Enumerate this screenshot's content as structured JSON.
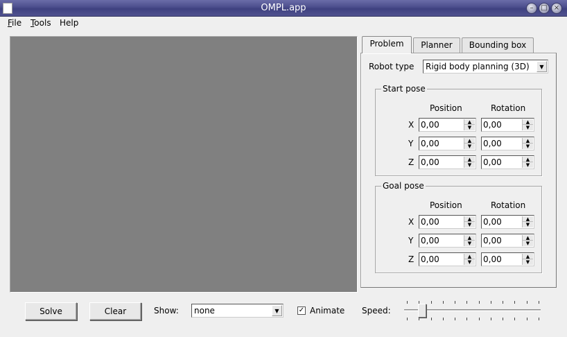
{
  "window": {
    "title": "OMPL.app"
  },
  "menu": {
    "file": "File",
    "tools": "Tools",
    "help": "Help"
  },
  "tabs": [
    {
      "label": "Problem",
      "active": true
    },
    {
      "label": "Planner",
      "active": false
    },
    {
      "label": "Bounding box",
      "active": false
    }
  ],
  "problem": {
    "robot_type_label": "Robot type",
    "robot_type_value": "Rigid body planning (3D)",
    "start_pose": {
      "title": "Start pose",
      "position_header": "Position",
      "rotation_header": "Rotation",
      "rows": [
        {
          "axis": "X",
          "position": "0,00",
          "rotation": "0,00"
        },
        {
          "axis": "Y",
          "position": "0,00",
          "rotation": "0,00"
        },
        {
          "axis": "Z",
          "position": "0,00",
          "rotation": "0,00"
        }
      ]
    },
    "goal_pose": {
      "title": "Goal pose",
      "position_header": "Position",
      "rotation_header": "Rotation",
      "rows": [
        {
          "axis": "X",
          "position": "0,00",
          "rotation": "0,00"
        },
        {
          "axis": "Y",
          "position": "0,00",
          "rotation": "0,00"
        },
        {
          "axis": "Z",
          "position": "0,00",
          "rotation": "0,00"
        }
      ]
    }
  },
  "bottom": {
    "solve_label": "Solve",
    "clear_label": "Clear",
    "show_label": "Show:",
    "show_value": "none",
    "animate_label": "Animate",
    "animate_checked": true,
    "speed_label": "Speed:",
    "speed_fraction": 0.11
  },
  "icons": {
    "checkmark": "✓",
    "dropdown": "▼",
    "spin_up": "▲",
    "spin_down": "▼"
  }
}
